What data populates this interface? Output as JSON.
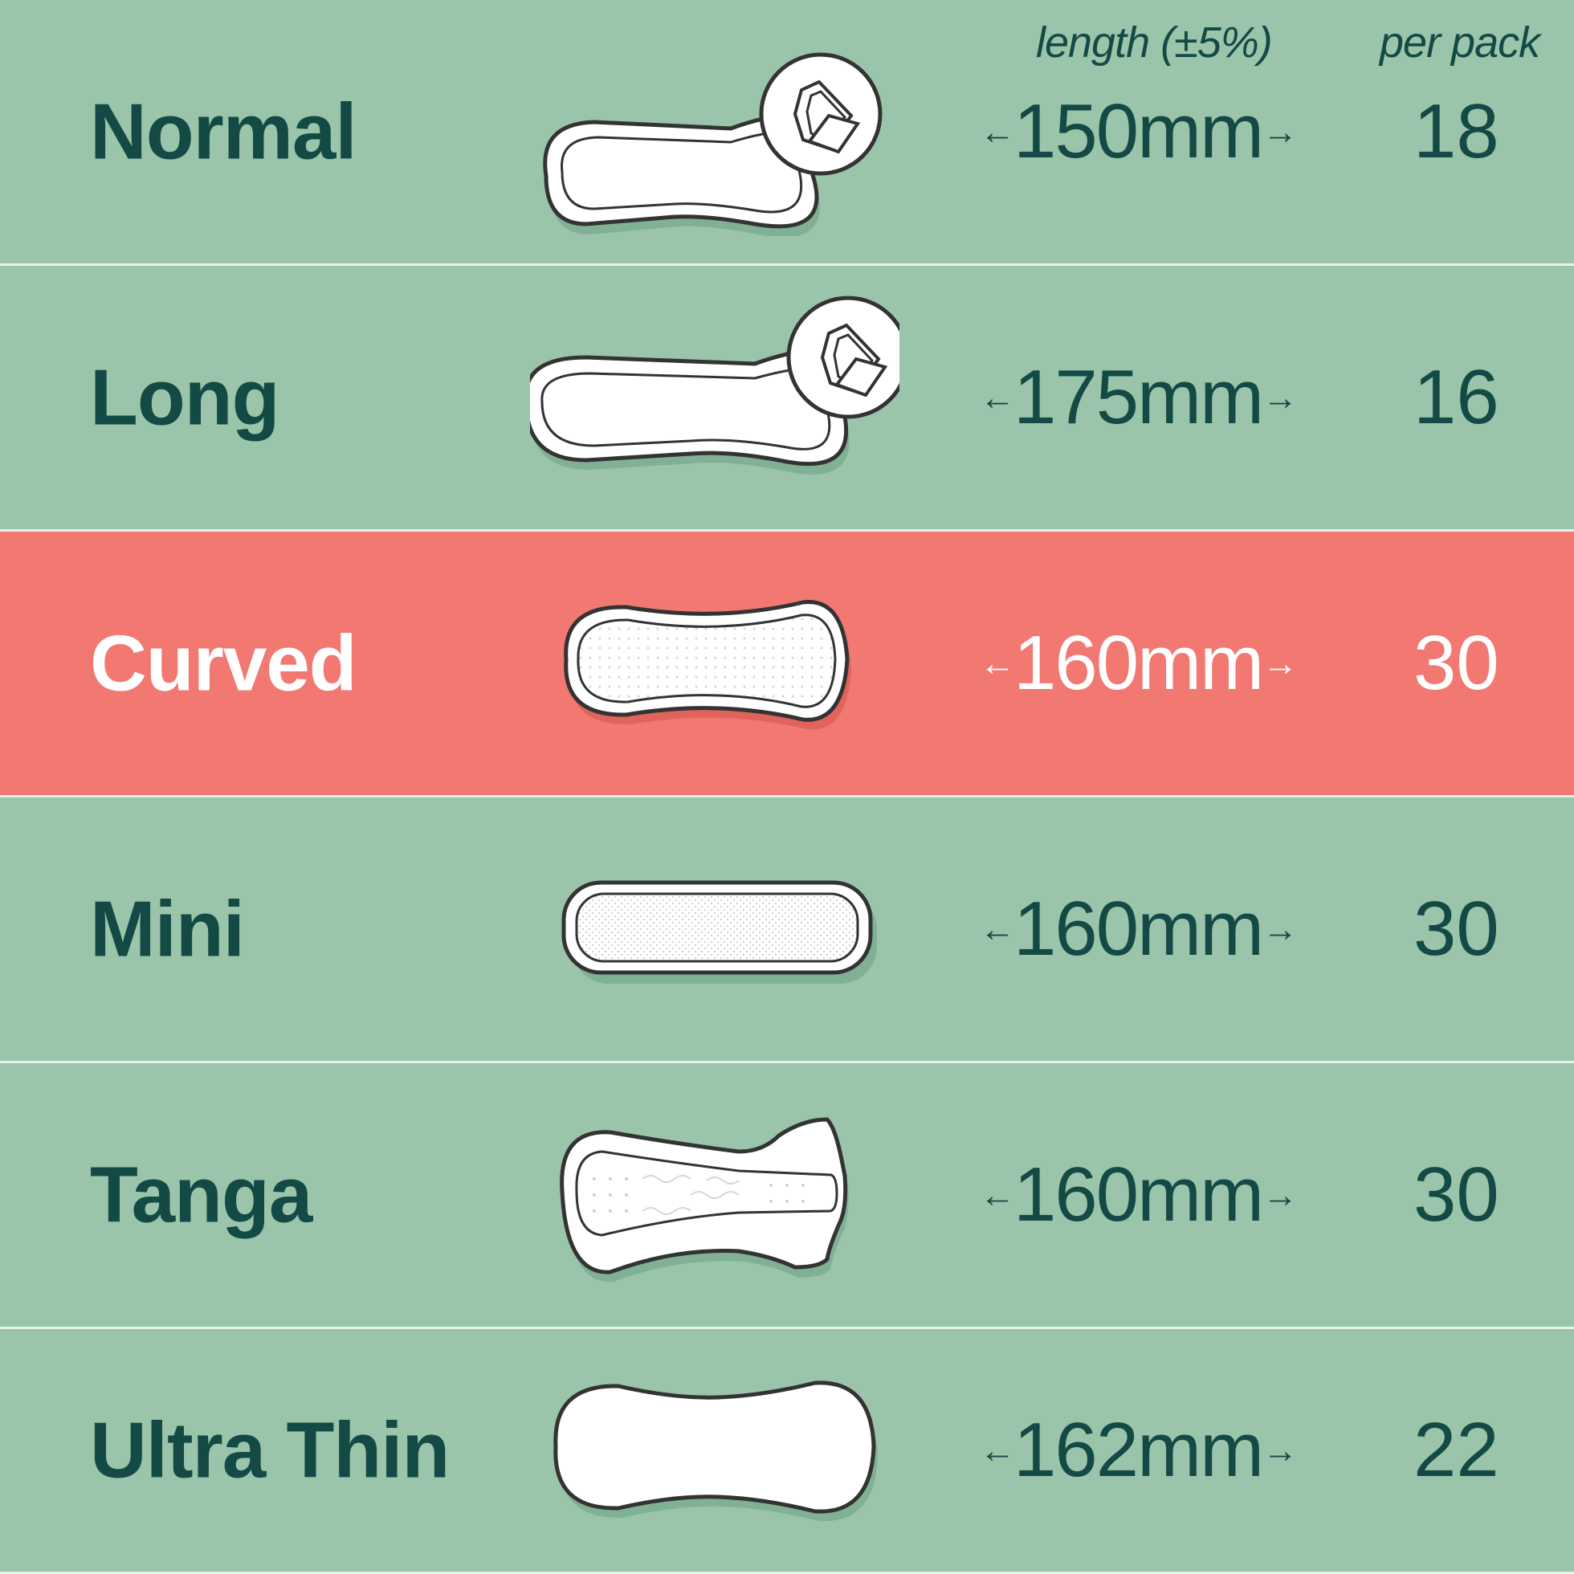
{
  "header": {
    "length_label": "length (±5%)",
    "pack_label": "per pack"
  },
  "colors": {
    "row_background": "#9bc5aa",
    "highlight_background": "#f27872",
    "text_dark": "#144a45",
    "text_light": "#ffffff"
  },
  "rows": [
    {
      "name": "Normal",
      "length": "150mm",
      "per_pack": "18",
      "icon": "liner-winged-icon",
      "highlighted": false
    },
    {
      "name": "Long",
      "length": "175mm",
      "per_pack": "16",
      "icon": "liner-winged-long-icon",
      "highlighted": false
    },
    {
      "name": "Curved",
      "length": "160mm",
      "per_pack": "30",
      "icon": "liner-curved-icon",
      "highlighted": true
    },
    {
      "name": "Mini",
      "length": "160mm",
      "per_pack": "30",
      "icon": "liner-mini-icon",
      "highlighted": false
    },
    {
      "name": "Tanga",
      "length": "160mm",
      "per_pack": "30",
      "icon": "liner-tanga-icon",
      "highlighted": false
    },
    {
      "name": "Ultra Thin",
      "length": "162mm",
      "per_pack": "22",
      "icon": "liner-ultra-thin-icon",
      "highlighted": false
    }
  ],
  "arrows": {
    "left": "←",
    "right": "→"
  }
}
